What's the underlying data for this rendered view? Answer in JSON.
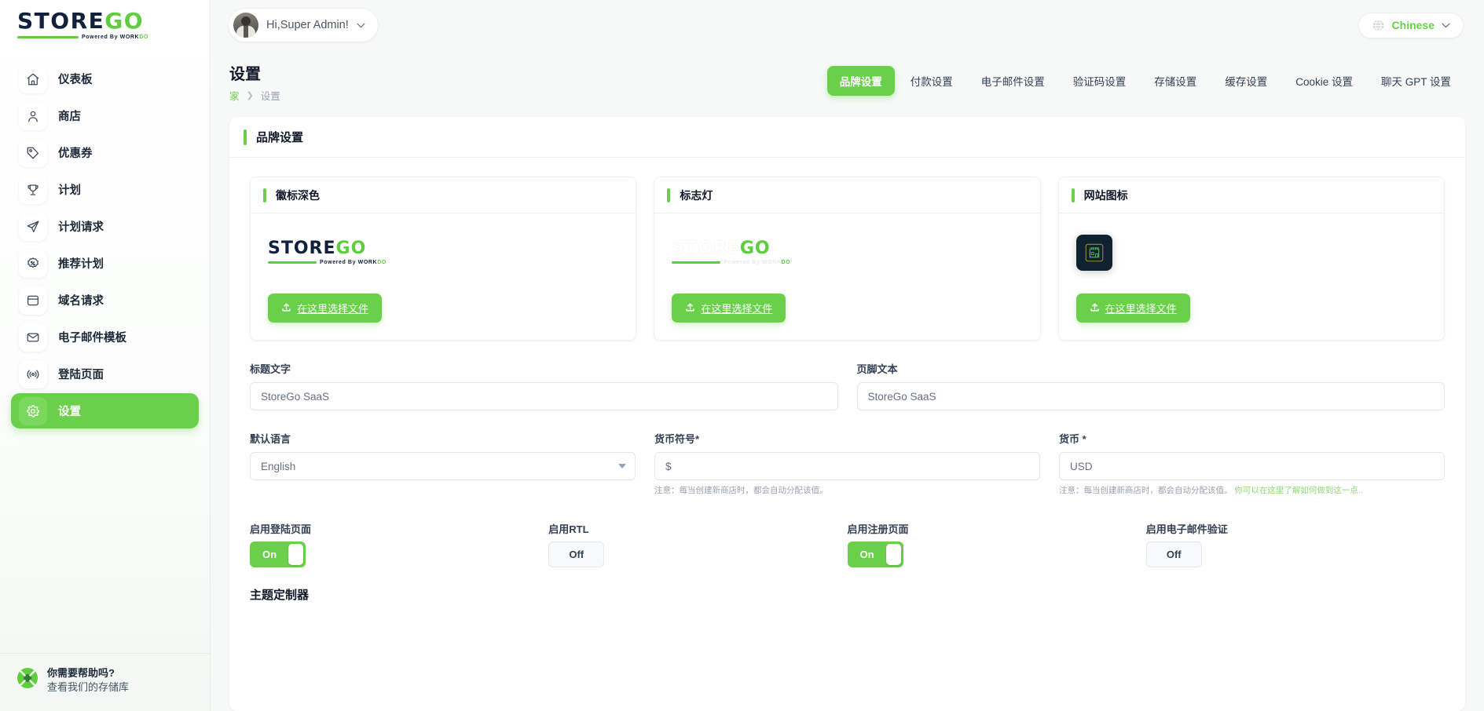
{
  "brand": {
    "logo_main": "STORE",
    "logo_accent": "GO",
    "powered_by": "Powered By ",
    "powered_brand": "WORK",
    "powered_brand_accent": "DO"
  },
  "sidebar": {
    "items": [
      {
        "label": "仪表板",
        "icon": "home-icon",
        "active": false
      },
      {
        "label": "商店",
        "icon": "user-icon",
        "active": false
      },
      {
        "label": "优惠券",
        "icon": "tag-icon",
        "active": false
      },
      {
        "label": "计划",
        "icon": "trophy-icon",
        "active": false
      },
      {
        "label": "计划请求",
        "icon": "send-icon",
        "active": false
      },
      {
        "label": "推荐计划",
        "icon": "badge-percent-icon",
        "active": false
      },
      {
        "label": "域名请求",
        "icon": "window-icon",
        "active": false
      },
      {
        "label": "电子邮件模板",
        "icon": "mail-icon",
        "active": false
      },
      {
        "label": "登陆页面",
        "icon": "broadcast-icon",
        "active": false
      },
      {
        "label": "设置",
        "icon": "gear-icon",
        "active": true
      }
    ],
    "help": {
      "title": "你需要帮助吗?",
      "subtitle": "查看我们的存储库"
    }
  },
  "topbar": {
    "user_greeting": "Hi,Super Admin!",
    "language": "Chinese"
  },
  "page": {
    "title": "设置",
    "breadcrumb_home": "家",
    "breadcrumb_separator": "❯",
    "breadcrumb_current": "设置"
  },
  "tabs": [
    {
      "label": "品牌设置",
      "active": true
    },
    {
      "label": "付款设置",
      "active": false
    },
    {
      "label": "电子邮件设置",
      "active": false
    },
    {
      "label": "验证码设置",
      "active": false
    },
    {
      "label": "存储设置",
      "active": false
    },
    {
      "label": "缓存设置",
      "active": false
    },
    {
      "label": "Cookie 设置",
      "active": false
    },
    {
      "label": "聊天 GPT 设置",
      "active": false
    }
  ],
  "panel": {
    "title": "品牌设置",
    "cards": [
      {
        "title": "徽标深色",
        "upload_label": "在这里选择文件",
        "preview": "logo-dark"
      },
      {
        "title": "标志灯",
        "upload_label": "在这里选择文件",
        "preview": "logo-light"
      },
      {
        "title": "网站图标",
        "upload_label": "在这里选择文件",
        "preview": "favicon"
      }
    ],
    "fields": {
      "title_text_label": "标题文字",
      "title_text_value": "StoreGo SaaS",
      "footer_text_label": "页脚文本",
      "footer_text_value": "StoreGo SaaS",
      "default_language_label": "默认语言",
      "default_language_value": "English",
      "currency_symbol_label": "货币符号*",
      "currency_symbol_value": "$",
      "currency_label": "货币 *",
      "currency_value": "USD",
      "currency_symbol_hint": "注意：每当创建新商店时，都会自动分配该值。",
      "currency_hint": "注意：每当创建新商店时，都会自动分配该值。",
      "currency_hint_link": "你可以在这里了解如何做到这一点.."
    },
    "toggles": [
      {
        "label": "启用登陆页面",
        "state": "On",
        "on": true
      },
      {
        "label": "启用RTL",
        "state": "Off",
        "on": false
      },
      {
        "label": "启用注册页面",
        "state": "On",
        "on": true
      },
      {
        "label": "启用电子邮件验证",
        "state": "Off",
        "on": false
      }
    ],
    "theme_section_title": "主题定制器"
  },
  "colors": {
    "accent_green": "#6ad04a",
    "logo_dark_navy": "#11213b",
    "text_dark": "#101828",
    "text_muted": "#98a2b3"
  }
}
